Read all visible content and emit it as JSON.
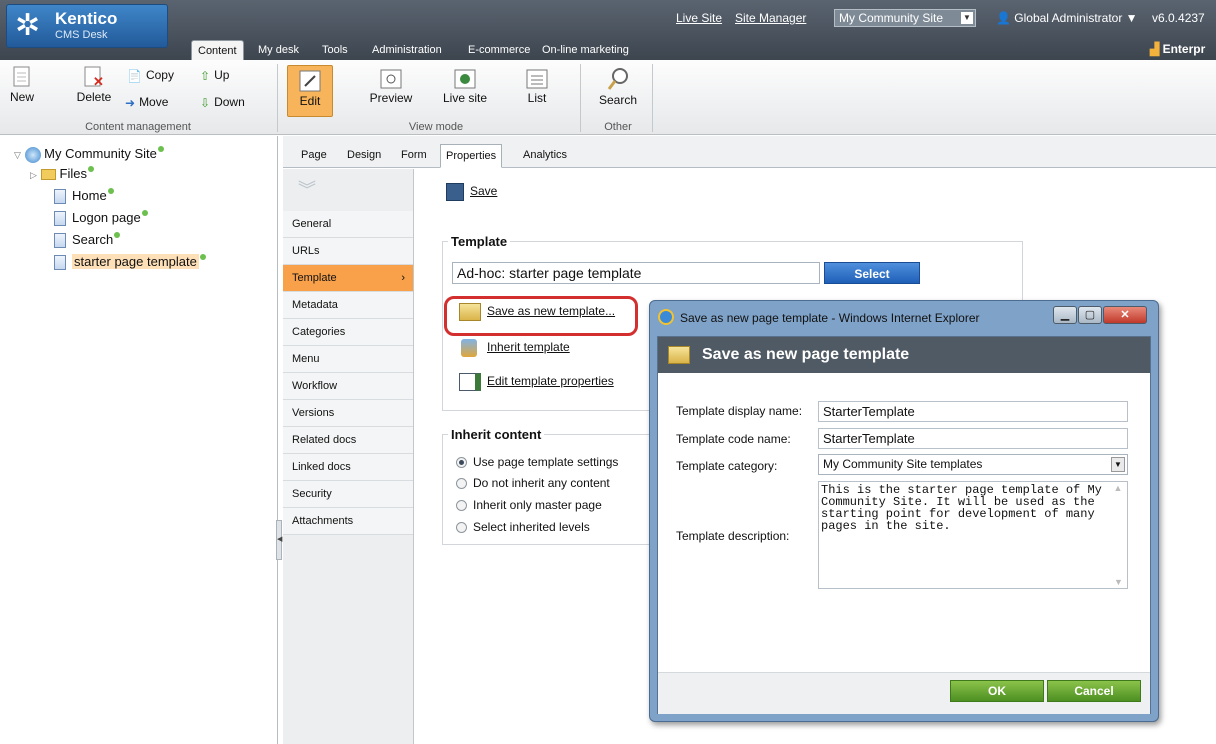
{
  "topbar": {
    "logo_name": "Kentico",
    "logo_sub": "CMS Desk",
    "tabs": [
      "Content",
      "My desk",
      "Tools",
      "Administration",
      "E-commerce",
      "On-line marketing"
    ],
    "links": [
      "Live Site",
      "Site Manager"
    ],
    "site_select": "My Community Site",
    "user": "Global Administrator ▼",
    "version": "v6.0.4237",
    "edition": "Enterpr"
  },
  "ribbon": {
    "new": "New",
    "delete": "Delete",
    "copy": "Copy",
    "move": "Move",
    "up": "Up",
    "down": "Down",
    "group1": "Content management",
    "edit": "Edit",
    "preview": "Preview",
    "live_site": "Live site",
    "list": "List",
    "group2": "View mode",
    "search": "Search",
    "group3": "Other"
  },
  "tree": {
    "root": "My Community Site",
    "items": [
      "Files",
      "Home",
      "Logon page",
      "Search",
      "starter page template"
    ]
  },
  "page_tabs": [
    "Page",
    "Design",
    "Form",
    "Properties",
    "Analytics"
  ],
  "vertical_nav": [
    "General",
    "URLs",
    "Template",
    "Metadata",
    "Categories",
    "Menu",
    "Workflow",
    "Versions",
    "Related docs",
    "Linked docs",
    "Security",
    "Attachments"
  ],
  "content": {
    "save": "Save",
    "template_legend": "Template",
    "template_value": "Ad-hoc: starter page template",
    "select_btn": "Select",
    "save_as_new": "Save as new template...",
    "inherit_template": "Inherit template",
    "edit_props": "Edit template properties",
    "inherit_legend": "Inherit content",
    "radios": [
      "Use page template settings",
      "Do not inherit any content",
      "Inherit only master page",
      "Select inherited levels"
    ]
  },
  "dialog": {
    "window_title": "Save as new page template - Windows Internet Explorer",
    "header": "Save as new page template",
    "display_name_label": "Template display name:",
    "display_name": "StarterTemplate",
    "code_name_label": "Template code name:",
    "code_name": "StarterTemplate",
    "category_label": "Template category:",
    "category": "My Community Site templates",
    "description_label": "Template description:",
    "description": "This is the starter page template of My Community Site. It will be used as the starting point for development of many pages in the site.",
    "ok": "OK",
    "cancel": "Cancel"
  },
  "colors": {
    "accent_orange": "#f8a14a",
    "select_blue": "#2f6fc8",
    "ok_green": "#5fa02e",
    "highlight_red": "#d32f2f"
  }
}
